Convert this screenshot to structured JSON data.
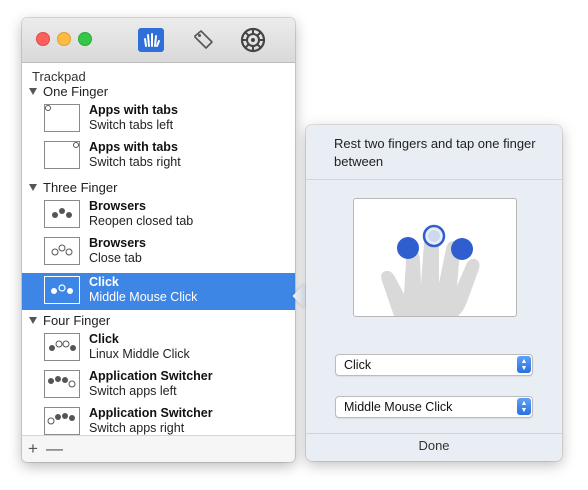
{
  "window": {
    "toolbar_icons": [
      "hand-gesture-icon",
      "tag-icon",
      "gear-icon"
    ]
  },
  "sidebar": {
    "section_title": "Trackpad",
    "groups": [
      {
        "label": "One Finger",
        "items": [
          {
            "title": "Apps with tabs",
            "subtitle": "Switch tabs left"
          },
          {
            "title": "Apps with tabs",
            "subtitle": "Switch tabs right"
          }
        ]
      },
      {
        "label": "Three Finger",
        "items": [
          {
            "title": "Browsers",
            "subtitle": "Reopen closed tab"
          },
          {
            "title": "Browsers",
            "subtitle": "Close tab"
          },
          {
            "title": "Click",
            "subtitle": "Middle Mouse Click",
            "selected": true
          }
        ]
      },
      {
        "label": "Four Finger",
        "items": [
          {
            "title": "Click",
            "subtitle": "Linux Middle Click"
          },
          {
            "title": "Application Switcher",
            "subtitle": "Switch apps left"
          },
          {
            "title": "Application Switcher",
            "subtitle": "Switch apps right"
          }
        ]
      }
    ],
    "footer": {
      "add": "+",
      "remove": "—"
    }
  },
  "popover": {
    "instruction": "Rest two fingers and tap one finger between",
    "action_select": "Click",
    "detail_select": "Middle Mouse Click",
    "done": "Done"
  },
  "colors": {
    "selection": "#3d86e5",
    "accent": "#2a6fe0"
  }
}
